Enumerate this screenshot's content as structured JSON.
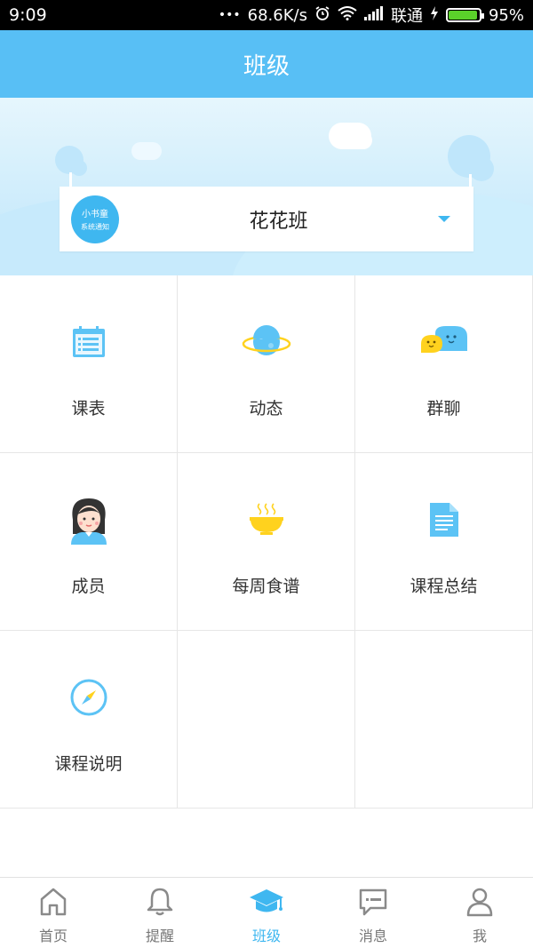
{
  "status_bar": {
    "time": "9:09",
    "dots": "•••",
    "speed": "68.6K/s",
    "carrier": "联通",
    "battery": "95%",
    "battery_level": 0.95
  },
  "header": {
    "title": "班级"
  },
  "class_selector": {
    "logo_line1": "小书童",
    "logo_line2": "系统通知",
    "class_name": "花花班"
  },
  "features": [
    {
      "label": "课表",
      "icon": "calendar-icon"
    },
    {
      "label": "动态",
      "icon": "planet-icon"
    },
    {
      "label": "群聊",
      "icon": "chat-bubbles-icon"
    },
    {
      "label": "成员",
      "icon": "girl-avatar-icon"
    },
    {
      "label": "每周食谱",
      "icon": "noodle-bowl-icon"
    },
    {
      "label": "课程总结",
      "icon": "document-icon"
    },
    {
      "label": "课程说明",
      "icon": "compass-icon"
    }
  ],
  "tabs": [
    {
      "label": "首页",
      "icon": "home-icon"
    },
    {
      "label": "提醒",
      "icon": "bell-icon"
    },
    {
      "label": "班级",
      "icon": "graduation-cap-icon",
      "active": true
    },
    {
      "label": "消息",
      "icon": "message-icon"
    },
    {
      "label": "我",
      "icon": "user-icon"
    }
  ],
  "colors": {
    "accent": "#3fb7f0",
    "header": "#58bff5",
    "icon_yellow": "#ffd21e",
    "inactive": "#777777"
  }
}
